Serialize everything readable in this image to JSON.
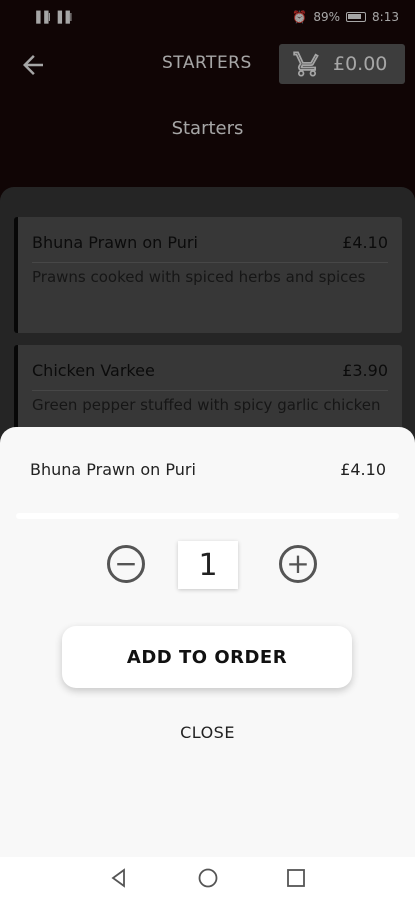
{
  "status_bar": {
    "signal": "▐▐l ▐▐l",
    "battery": "89%",
    "time": "8:13"
  },
  "header": {
    "title": "STARTERS",
    "cart_total": "£0.00"
  },
  "page_title": "Starters",
  "menu_items": [
    {
      "name": "Bhuna Prawn on Puri",
      "price": "£4.10",
      "description": "Prawns cooked with spiced herbs and spices"
    },
    {
      "name": "Chicken Varkee",
      "price": "£3.90",
      "description": "Green pepper stuffed with spicy garlic chicken"
    }
  ],
  "sheet": {
    "item_name": "Bhuna Prawn on Puri",
    "item_price": "£4.10",
    "quantity": "1",
    "add_label": "ADD TO ORDER",
    "close_label": "CLOSE"
  },
  "icons": {
    "back": "arrow-left-icon",
    "cart": "cart-icon",
    "minus": "minus-circle-icon",
    "plus": "plus-circle-icon",
    "nav_back": "triangle-back-icon",
    "nav_home": "circle-home-icon",
    "nav_recent": "square-recent-icon"
  }
}
